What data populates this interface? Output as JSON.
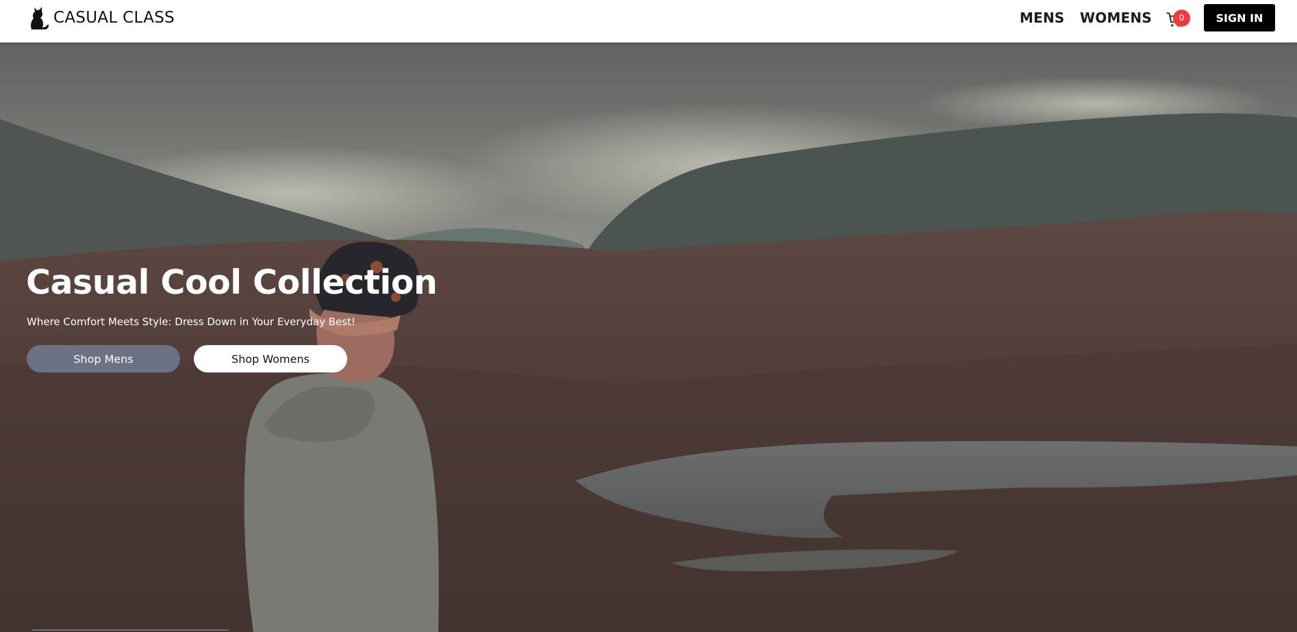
{
  "brand": {
    "name": "CASUAL CLASS",
    "logo_icon": "cat-icon"
  },
  "nav": {
    "links": [
      "MENS",
      "WOMENS"
    ],
    "cart_count": "0",
    "cart_icon": "shopping-cart-icon",
    "signin_label": "SIGN IN"
  },
  "hero": {
    "title": "Casual Cool Collection",
    "subtitle": "Where Comfort Meets Style: Dress Down in Your Everyday Best!",
    "buttons": [
      "Shop Mens",
      "Shop Womens"
    ]
  },
  "colors": {
    "navbar_bg": "#ffffff",
    "signin_bg": "#000000",
    "cart_badge": "#ef3b3b",
    "shop_mens_bg": "#6c7283",
    "shop_womens_bg": "#ffffff"
  }
}
